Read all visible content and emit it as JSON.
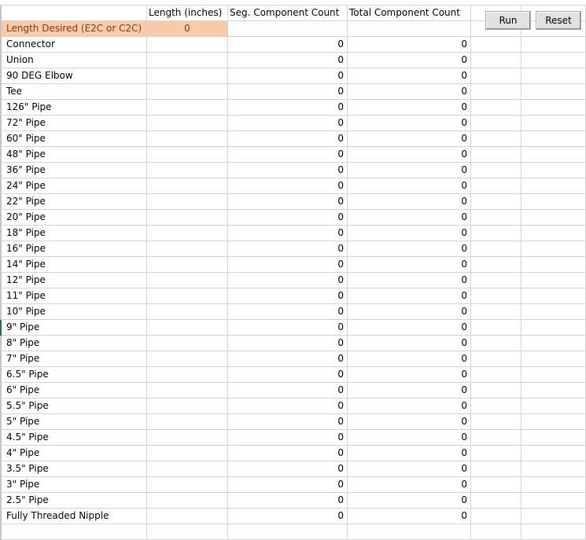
{
  "headers": {
    "length": "Length (inches)",
    "seg_count": "Seg. Component Count",
    "total_count": "Total Component Count"
  },
  "input_row": {
    "label": "Length Desired (E2C or C2C)",
    "value": "0"
  },
  "buttons": {
    "run": "Run",
    "reset": "Reset"
  },
  "components": [
    {
      "name": "Connector",
      "seg": "0",
      "total": "0"
    },
    {
      "name": "Union",
      "seg": "0",
      "total": "0"
    },
    {
      "name": "90 DEG Elbow",
      "seg": "0",
      "total": "0"
    },
    {
      "name": "Tee",
      "seg": "0",
      "total": "0"
    },
    {
      "name": "126\" Pipe",
      "seg": "0",
      "total": "0"
    },
    {
      "name": "72\" Pipe",
      "seg": "0",
      "total": "0"
    },
    {
      "name": "60\" Pipe",
      "seg": "0",
      "total": "0"
    },
    {
      "name": "48\" Pipe",
      "seg": "0",
      "total": "0"
    },
    {
      "name": "36\" Pipe",
      "seg": "0",
      "total": "0"
    },
    {
      "name": "24\" Pipe",
      "seg": "0",
      "total": "0"
    },
    {
      "name": "22\" Pipe",
      "seg": "0",
      "total": "0"
    },
    {
      "name": "20\" Pipe",
      "seg": "0",
      "total": "0"
    },
    {
      "name": "18\" Pipe",
      "seg": "0",
      "total": "0"
    },
    {
      "name": "16\" Pipe",
      "seg": "0",
      "total": "0"
    },
    {
      "name": "14\" Pipe",
      "seg": "0",
      "total": "0"
    },
    {
      "name": "12\" Pipe",
      "seg": "0",
      "total": "0"
    },
    {
      "name": "11\" Pipe",
      "seg": "0",
      "total": "0"
    },
    {
      "name": "10\" Pipe",
      "seg": "0",
      "total": "0"
    },
    {
      "name": "9\" Pipe",
      "seg": "0",
      "total": "0"
    },
    {
      "name": "8\" Pipe",
      "seg": "0",
      "total": "0"
    },
    {
      "name": "7\" Pipe",
      "seg": "0",
      "total": "0"
    },
    {
      "name": "6.5\" Pipe",
      "seg": "0",
      "total": "0"
    },
    {
      "name": "6\" Pipe",
      "seg": "0",
      "total": "0"
    },
    {
      "name": "5.5\" Pipe",
      "seg": "0",
      "total": "0"
    },
    {
      "name": "5\" Pipe",
      "seg": "0",
      "total": "0"
    },
    {
      "name": "4.5\" Pipe",
      "seg": "0",
      "total": "0"
    },
    {
      "name": "4\" Pipe",
      "seg": "0",
      "total": "0"
    },
    {
      "name": "3.5\" Pipe",
      "seg": "0",
      "total": "0"
    },
    {
      "name": "3\" Pipe",
      "seg": "0",
      "total": "0"
    },
    {
      "name": "2.5\" Pipe",
      "seg": "0",
      "total": "0"
    },
    {
      "name": "Fully Threaded Nipple",
      "seg": "0",
      "total": "0"
    }
  ]
}
